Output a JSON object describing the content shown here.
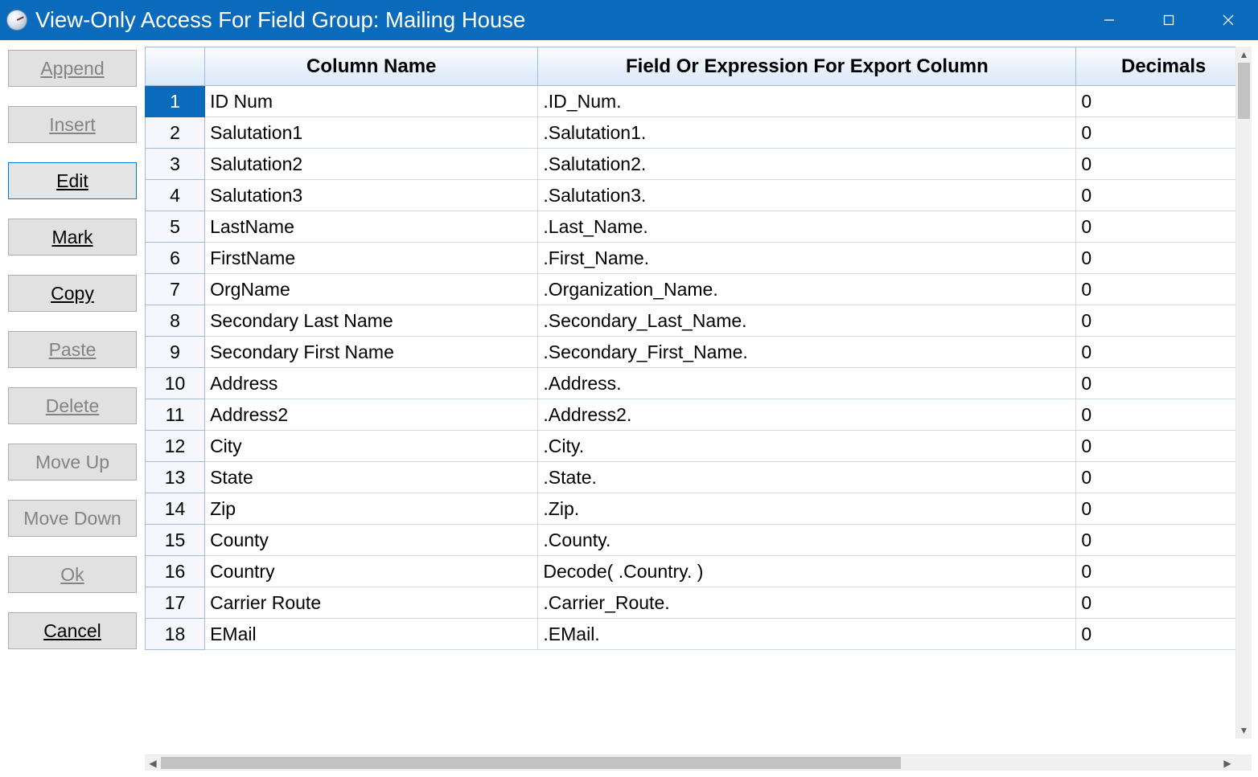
{
  "window": {
    "title": "View-Only Access For Field Group: Mailing House"
  },
  "sidebar": {
    "append": "Append",
    "insert": "Insert",
    "edit": "Edit",
    "mark": "Mark",
    "copy": "Copy",
    "paste": "Paste",
    "delete": "Delete",
    "moveup": "Move Up",
    "movedown": "Move Down",
    "ok": "Ok",
    "cancel": "Cancel"
  },
  "grid": {
    "headers": {
      "rownum": "",
      "colname": "Column Name",
      "expr": "Field Or Expression For Export Column",
      "dec": "Decimals"
    },
    "rows": [
      {
        "n": "1",
        "name": "ID Num",
        "expr": ".ID_Num.",
        "dec": "0"
      },
      {
        "n": "2",
        "name": "Salutation1",
        "expr": ".Salutation1.",
        "dec": "0"
      },
      {
        "n": "3",
        "name": "Salutation2",
        "expr": ".Salutation2.",
        "dec": "0"
      },
      {
        "n": "4",
        "name": "Salutation3",
        "expr": ".Salutation3.",
        "dec": "0"
      },
      {
        "n": "5",
        "name": "LastName",
        "expr": ".Last_Name.",
        "dec": "0"
      },
      {
        "n": "6",
        "name": "FirstName",
        "expr": ".First_Name.",
        "dec": "0"
      },
      {
        "n": "7",
        "name": "OrgName",
        "expr": ".Organization_Name.",
        "dec": "0"
      },
      {
        "n": "8",
        "name": "Secondary Last Name",
        "expr": ".Secondary_Last_Name.",
        "dec": "0"
      },
      {
        "n": "9",
        "name": "Secondary First Name",
        "expr": ".Secondary_First_Name.",
        "dec": "0"
      },
      {
        "n": "10",
        "name": "Address",
        "expr": ".Address.",
        "dec": "0"
      },
      {
        "n": "11",
        "name": "Address2",
        "expr": ".Address2.",
        "dec": "0"
      },
      {
        "n": "12",
        "name": "City",
        "expr": ".City.",
        "dec": "0"
      },
      {
        "n": "13",
        "name": "State",
        "expr": ".State.",
        "dec": "0"
      },
      {
        "n": "14",
        "name": "Zip",
        "expr": ".Zip.",
        "dec": "0"
      },
      {
        "n": "15",
        "name": "County",
        "expr": ".County.",
        "dec": "0"
      },
      {
        "n": "16",
        "name": "Country",
        "expr": "Decode( .Country. )",
        "dec": "0"
      },
      {
        "n": "17",
        "name": "Carrier Route",
        "expr": ".Carrier_Route.",
        "dec": "0"
      },
      {
        "n": "18",
        "name": "EMail",
        "expr": ".EMail.",
        "dec": "0"
      }
    ]
  }
}
